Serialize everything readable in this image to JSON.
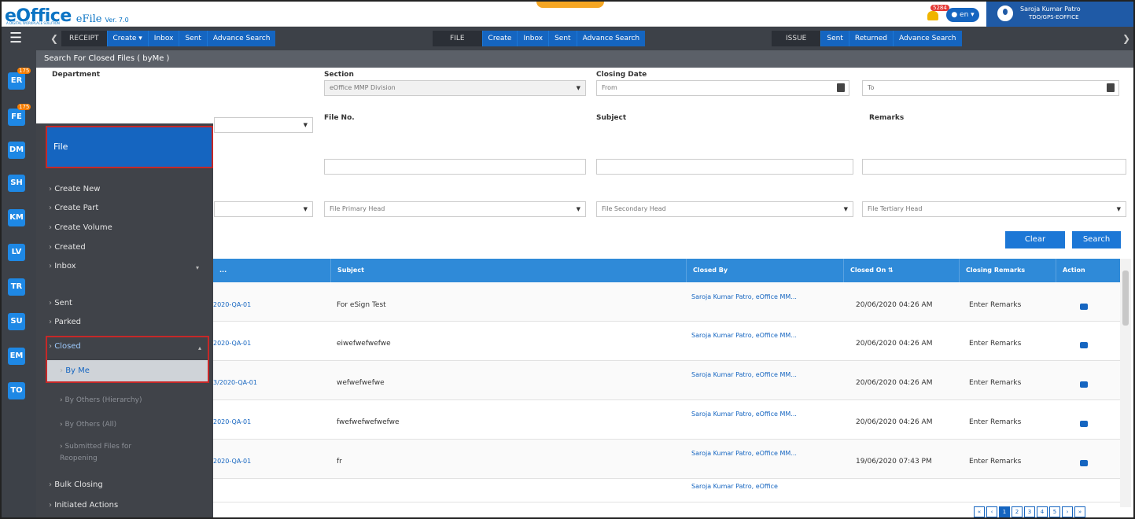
{
  "header": {
    "logo": "eOffice",
    "logo_sub": "A DIGITAL WORKPLACE SOLUTION",
    "app": "eFile",
    "version": "Ver. 7.0",
    "notification_count": "5284",
    "lang": "en",
    "user_name": "Saroja Kumar Patro",
    "user_role": "TDO/GPS-EOFFICE"
  },
  "nav": {
    "receipt": {
      "label": "RECEIPT",
      "items": [
        "Create",
        "Inbox",
        "Sent",
        "Advance Search"
      ]
    },
    "file": {
      "label": "FILE",
      "items": [
        "Create",
        "Inbox",
        "Sent",
        "Advance Search"
      ]
    },
    "issue": {
      "label": "ISSUE",
      "items": [
        "Sent",
        "Returned",
        "Advance Search"
      ]
    }
  },
  "rail": {
    "items": [
      "ER",
      "FE",
      "DM",
      "SH",
      "KM",
      "LV",
      "TR",
      "SU",
      "EM",
      "TO"
    ],
    "badges": [
      "175",
      "175"
    ]
  },
  "page_title": "Search For Closed Files ( byMe )",
  "form": {
    "department_label": "Department",
    "section_label": "Section",
    "section_value": "eOffice MMP Division",
    "closing_date_label": "Closing Date",
    "from_placeholder": "From",
    "to_placeholder": "To",
    "file_no_label": "File No.",
    "subject_label": "Subject",
    "remarks_label": "Remarks",
    "primary_head": "File Primary Head",
    "secondary_head": "File Secondary Head",
    "tertiary_head": "File Tertiary Head",
    "clear_label": "Clear",
    "search_label": "Search"
  },
  "table": {
    "columns": [
      "...",
      "Subject",
      "Closed By",
      "Closed On",
      "Closing Remarks",
      "Action"
    ],
    "rows": [
      {
        "file_no": "2020-QA-01",
        "subject": "For eSign Test",
        "closed_by": "Saroja Kumar Patro, eOffice MM...",
        "closed_on": "20/06/2020 04:26 AM",
        "remarks": "Enter Remarks"
      },
      {
        "file_no": "2020-QA-01",
        "subject": "eiwefwefwefwe",
        "closed_by": "Saroja Kumar Patro, eOffice MM...",
        "closed_on": "20/06/2020 04:26 AM",
        "remarks": "Enter Remarks"
      },
      {
        "file_no": "3/2020-QA-01",
        "subject": "wefwefwefwe",
        "closed_by": "Saroja Kumar Patro, eOffice MM...",
        "closed_on": "20/06/2020 04:26 AM",
        "remarks": "Enter Remarks"
      },
      {
        "file_no": "2020-QA-01",
        "subject": "fwefwefwefwefwe",
        "closed_by": "Saroja Kumar Patro, eOffice MM...",
        "closed_on": "20/06/2020 04:26 AM",
        "remarks": "Enter Remarks"
      },
      {
        "file_no": "2020-QA-01",
        "subject": "fr",
        "closed_by": "Saroja Kumar Patro, eOffice MM...",
        "closed_on": "19/06/2020 07:43 PM",
        "remarks": "Enter Remarks"
      },
      {
        "file_no": "",
        "subject": "",
        "closed_by": "Saroja Kumar Patro, eOffice",
        "closed_on": "",
        "remarks": ""
      }
    ],
    "pages": [
      "1",
      "2",
      "3",
      "4",
      "5"
    ]
  },
  "menu": {
    "title": "File",
    "items": [
      "Create New",
      "Create Part",
      "Create Volume",
      "Created",
      "Inbox",
      "Sent",
      "Parked",
      "Closed",
      "By Me",
      "By Others (Hierarchy)",
      "By Others (All)",
      "Submitted Files for Reopening",
      "Bulk Closing",
      "Initiated Actions"
    ]
  }
}
